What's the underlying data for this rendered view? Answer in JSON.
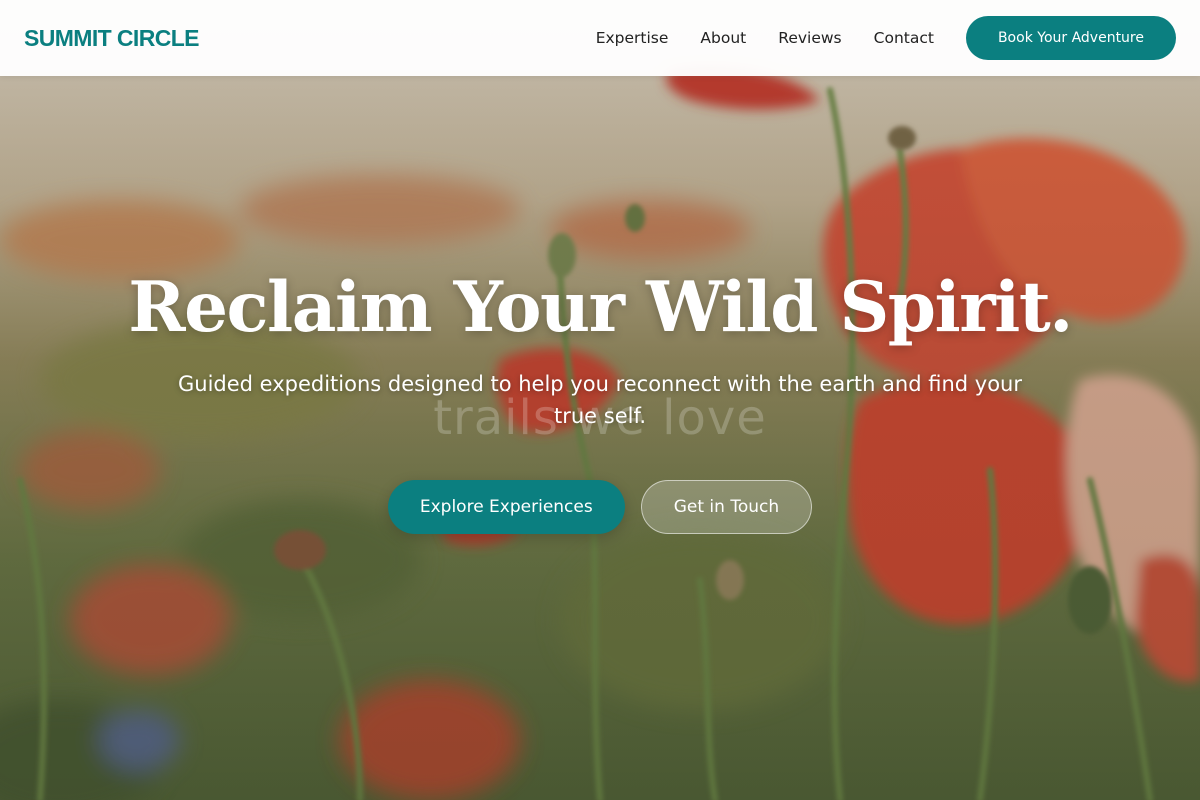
{
  "brand": {
    "name": "SUMMIT CIRCLE",
    "accent_color": "#0b7f80"
  },
  "nav": {
    "links": [
      {
        "label": "Expertise"
      },
      {
        "label": "About"
      },
      {
        "label": "Reviews"
      },
      {
        "label": "Contact"
      }
    ],
    "cta_label": "Book Your Adventure"
  },
  "hero": {
    "background_image": "poppy-field-photo",
    "title": "Reclaim Your Wild Spirit.",
    "subtitle": "Guided expeditions designed to help you reconnect with the earth and find your true self.",
    "ghost_text": "trails we love",
    "primary_button_label": "Explore Experiences",
    "secondary_button_label": "Get in Touch"
  }
}
